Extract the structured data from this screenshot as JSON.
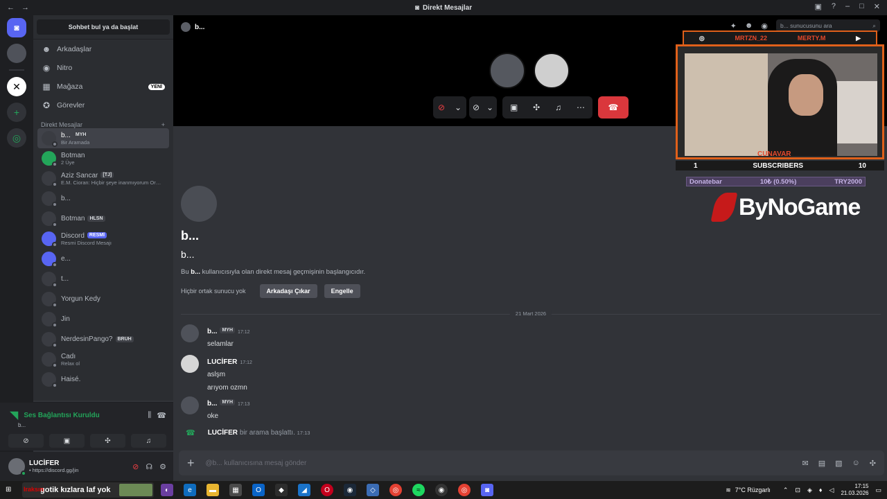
{
  "titlebar": {
    "title": "Direkt Mesajlar",
    "back": "←",
    "forward": "→"
  },
  "channels": {
    "search_label": "Sohbet bul ya da başlat",
    "nav": [
      {
        "icon": "friends-icon",
        "glyph": "☻",
        "label": "Arkadaşlar"
      },
      {
        "icon": "nitro-icon",
        "glyph": "◉",
        "label": "Nitro"
      },
      {
        "icon": "shop-icon",
        "glyph": "▦",
        "label": "Mağaza",
        "badge": "YENİ"
      },
      {
        "icon": "quests-icon",
        "glyph": "✪",
        "label": "Görevler"
      }
    ],
    "dm_header": "Direkt Mesajlar",
    "dm_add": "+",
    "dms": [
      {
        "name": "b...",
        "tag": "MYH",
        "sub": "Bir Aramada",
        "active": true
      },
      {
        "name": "Botman",
        "sub": "2 Üye"
      },
      {
        "name": "Aziz Sancar",
        "tag": "[TJ]",
        "sub": "E.M. Cioran: Hiçbir şeye inanmıyorum Orma..."
      },
      {
        "name": "b...",
        "sub": ""
      },
      {
        "name": "Botman",
        "tag": "HLSN",
        "sub": ""
      },
      {
        "name": "Discord",
        "tag": "RESMİ",
        "sub": "Resmi Discord Mesajı"
      },
      {
        "name": "e...",
        "sub": ""
      },
      {
        "name": "t...",
        "sub": ""
      },
      {
        "name": "Yorgun Kedy",
        "sub": ""
      },
      {
        "name": "Jin",
        "sub": ""
      },
      {
        "name": "NerdesinPango?",
        "tag": "BRUH",
        "sub": ""
      },
      {
        "name": "Cadı",
        "sub": "Relax ol"
      },
      {
        "name": "Haisé.",
        "sub": ""
      }
    ]
  },
  "voice": {
    "status": "Ses Bağlantısı Kuruldu",
    "server": "b..."
  },
  "user": {
    "name": "LUCİFER",
    "status": "• https://discord.gg/jin"
  },
  "call": {
    "name": "b..."
  },
  "header": {
    "search_placeholder": "b... sunucusunu ara"
  },
  "intro": {
    "title": "b...",
    "subtitle": "b...",
    "desc_pre": "Bu ",
    "desc_bold": "b...",
    "desc_post": " kullanıcısıyla olan direkt mesaj geçmişinin başlangıcıdır.",
    "no_common": "Hiçbir ortak sunucu yok",
    "remove_friend": "Arkadaşı Çıkar",
    "block": "Engelle"
  },
  "divider_date": "21 Mart 2026",
  "messages": [
    {
      "author": "b...",
      "tag": "MYH",
      "time": "17:12",
      "lines": [
        "selamlar"
      ]
    },
    {
      "author": "LUCİFER",
      "time": "17:12",
      "lines": [
        "aslşm",
        "arıyom ozmn"
      ]
    },
    {
      "author": "b...",
      "tag": "MYH",
      "time": "17:13",
      "lines": [
        "oke"
      ]
    }
  ],
  "system": {
    "author": "LUCİFER",
    "text": " bir arama başlattı.",
    "time": "17:13"
  },
  "composer": {
    "placeholder": "@b... kullanıcısına mesaj gönder"
  },
  "overlay": {
    "instagram": "MRTZN_22",
    "youtube": "MERTY.M",
    "name": "CUNAVAR",
    "subs_left": "1",
    "subs_label": "SUBSCRIBERS",
    "subs_right": "10",
    "donate_label": "Donatebar",
    "donate_value": "10₺ (0.50%)",
    "donate_goal": "TRY2000",
    "logo": "ByNoGame"
  },
  "taskbar": {
    "search_text": "gotik kızlara laf yok",
    "search_overlay": "Iraksın",
    "weather": "7°C  Rüzgarlı",
    "time": "17:15",
    "date": "21.03.2026"
  }
}
